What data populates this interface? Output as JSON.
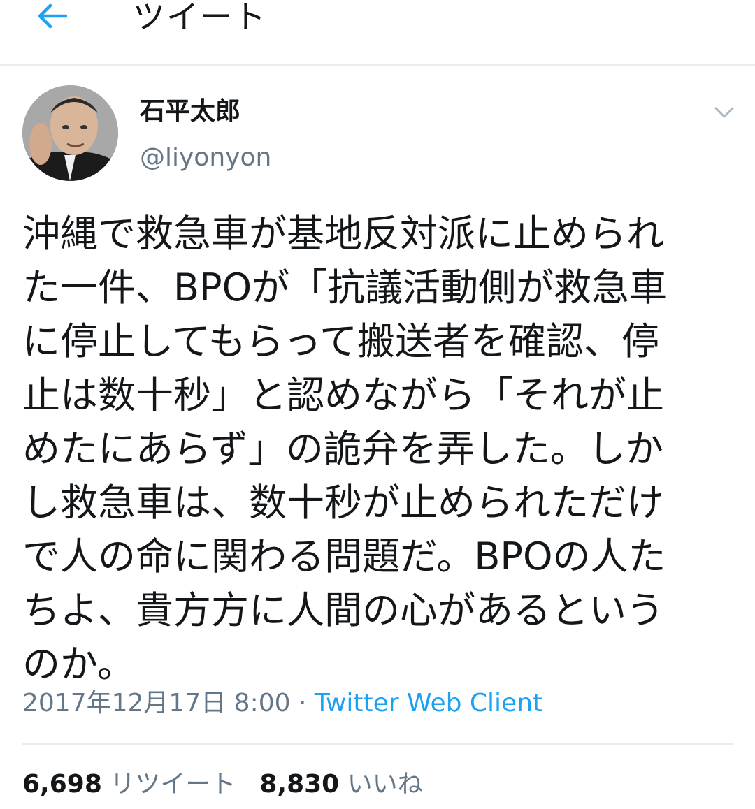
{
  "header": {
    "title": "ツイート",
    "back_icon": "arrow-left-icon",
    "accent_color": "#1da1f2"
  },
  "tweet": {
    "author": {
      "display_name": "石平太郎",
      "handle": "@liyonyon"
    },
    "menu_icon": "chevron-down-icon",
    "text_lines": [
      "沖縄で救急車が基地反対派に止められ",
      "た一件、BPOが「抗議活動側が救急車",
      "に停止してもらって搬送者を確認、停",
      "止は数十秒」と認めながら「それが止",
      "めたにあらず」の詭弁を弄した。しか",
      "し救急車は、数十秒が止められただけ",
      "で人の命に関わる問題だ。BPOの人た",
      "ちよ、貴方方に人間の心があるという",
      "のか。"
    ],
    "timestamp": "2017年12月17日 8:00",
    "separator": " · ",
    "client": "Twitter Web Client"
  },
  "stats": {
    "retweets": {
      "count": "6,698",
      "label": "リツイート"
    },
    "likes": {
      "count": "8,830",
      "label": "いいね"
    }
  }
}
